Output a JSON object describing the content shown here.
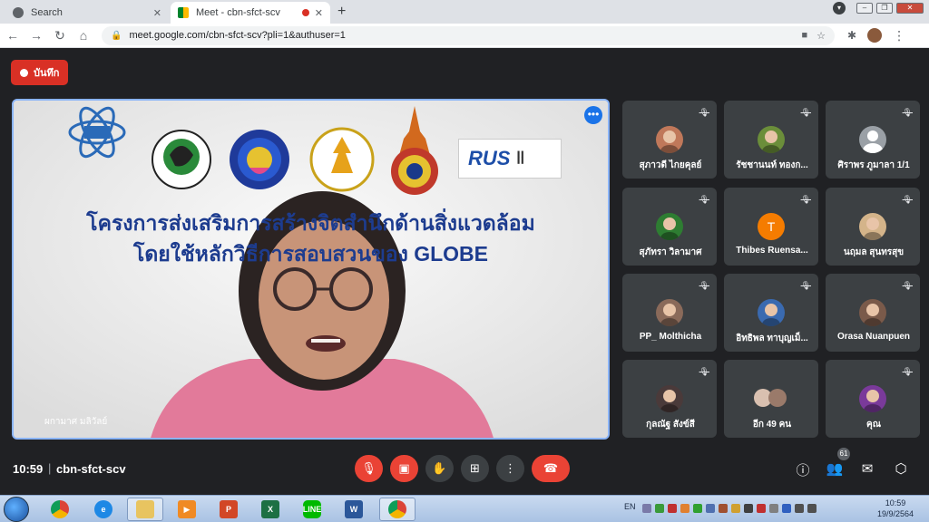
{
  "browser": {
    "tabs": [
      {
        "title": "Search",
        "icon": "globe-icon",
        "active": false
      },
      {
        "title": "Meet - cbn-sfct-scv",
        "icon": "meet-icon",
        "active": true
      }
    ],
    "url": "meet.google.com/cbn-sfct-scv?pli=1&authuser=1"
  },
  "meet": {
    "recording_label": "บันทึก",
    "banner_line1": "โครงการส่งเสริมการสร้างจิตสำนึกด้านสิ่งแวดล้อม",
    "banner_line2": "โดยใช้หลักวิธีการสอบสวนของ GLOBE",
    "logo_rus": "RUS",
    "speaker_name": "ผกามาศ มลิวัลย์",
    "time": "10:59",
    "meeting_code": "cbn-sfct-scv",
    "participant_count": "61",
    "participants": [
      {
        "name": "สุภาวดี ไกยคุลย์",
        "avatar": "photo",
        "color": "#c0785a"
      },
      {
        "name": "รัชชานนท์ ทองก...",
        "avatar": "photo",
        "color": "#6b8e3a"
      },
      {
        "name": "ศิราพร ภูมาลา 1/1",
        "avatar": "default",
        "color": "#9aa0a6"
      },
      {
        "name": "สุภัทรา วิลามาศ",
        "avatar": "photo",
        "color": "#2e7d32"
      },
      {
        "name": "Thibes Ruensa...",
        "avatar": "letter",
        "letter": "T",
        "color": "#f57c00"
      },
      {
        "name": "นฤมล สุนทรสุข",
        "avatar": "photo",
        "color": "#d4b48a"
      },
      {
        "name": "PP_ Molthicha",
        "avatar": "photo",
        "color": "#8a6a5a"
      },
      {
        "name": "อิทธิพล ทาบุญเม็...",
        "avatar": "photo",
        "color": "#3a6ab0"
      },
      {
        "name": "Orasa Nuanpuen",
        "avatar": "photo",
        "color": "#7a5a4a"
      },
      {
        "name": "กุลณัฐ สังข์สี",
        "avatar": "photo",
        "color": "#4a3a3a"
      },
      {
        "name": "อีก 49 คน",
        "avatar": "group",
        "color": "#9a7a6a"
      },
      {
        "name": "คุณ",
        "avatar": "photo",
        "color": "#7a3a9a"
      }
    ]
  },
  "taskbar": {
    "apps": [
      "Chrome",
      "Internet Explorer",
      "File Explorer",
      "Media Player",
      "PowerPoint",
      "Excel",
      "LINE",
      "Word",
      "Chrome"
    ],
    "language": "EN",
    "clock_time": "10:59",
    "clock_date": "19/9/2564"
  }
}
